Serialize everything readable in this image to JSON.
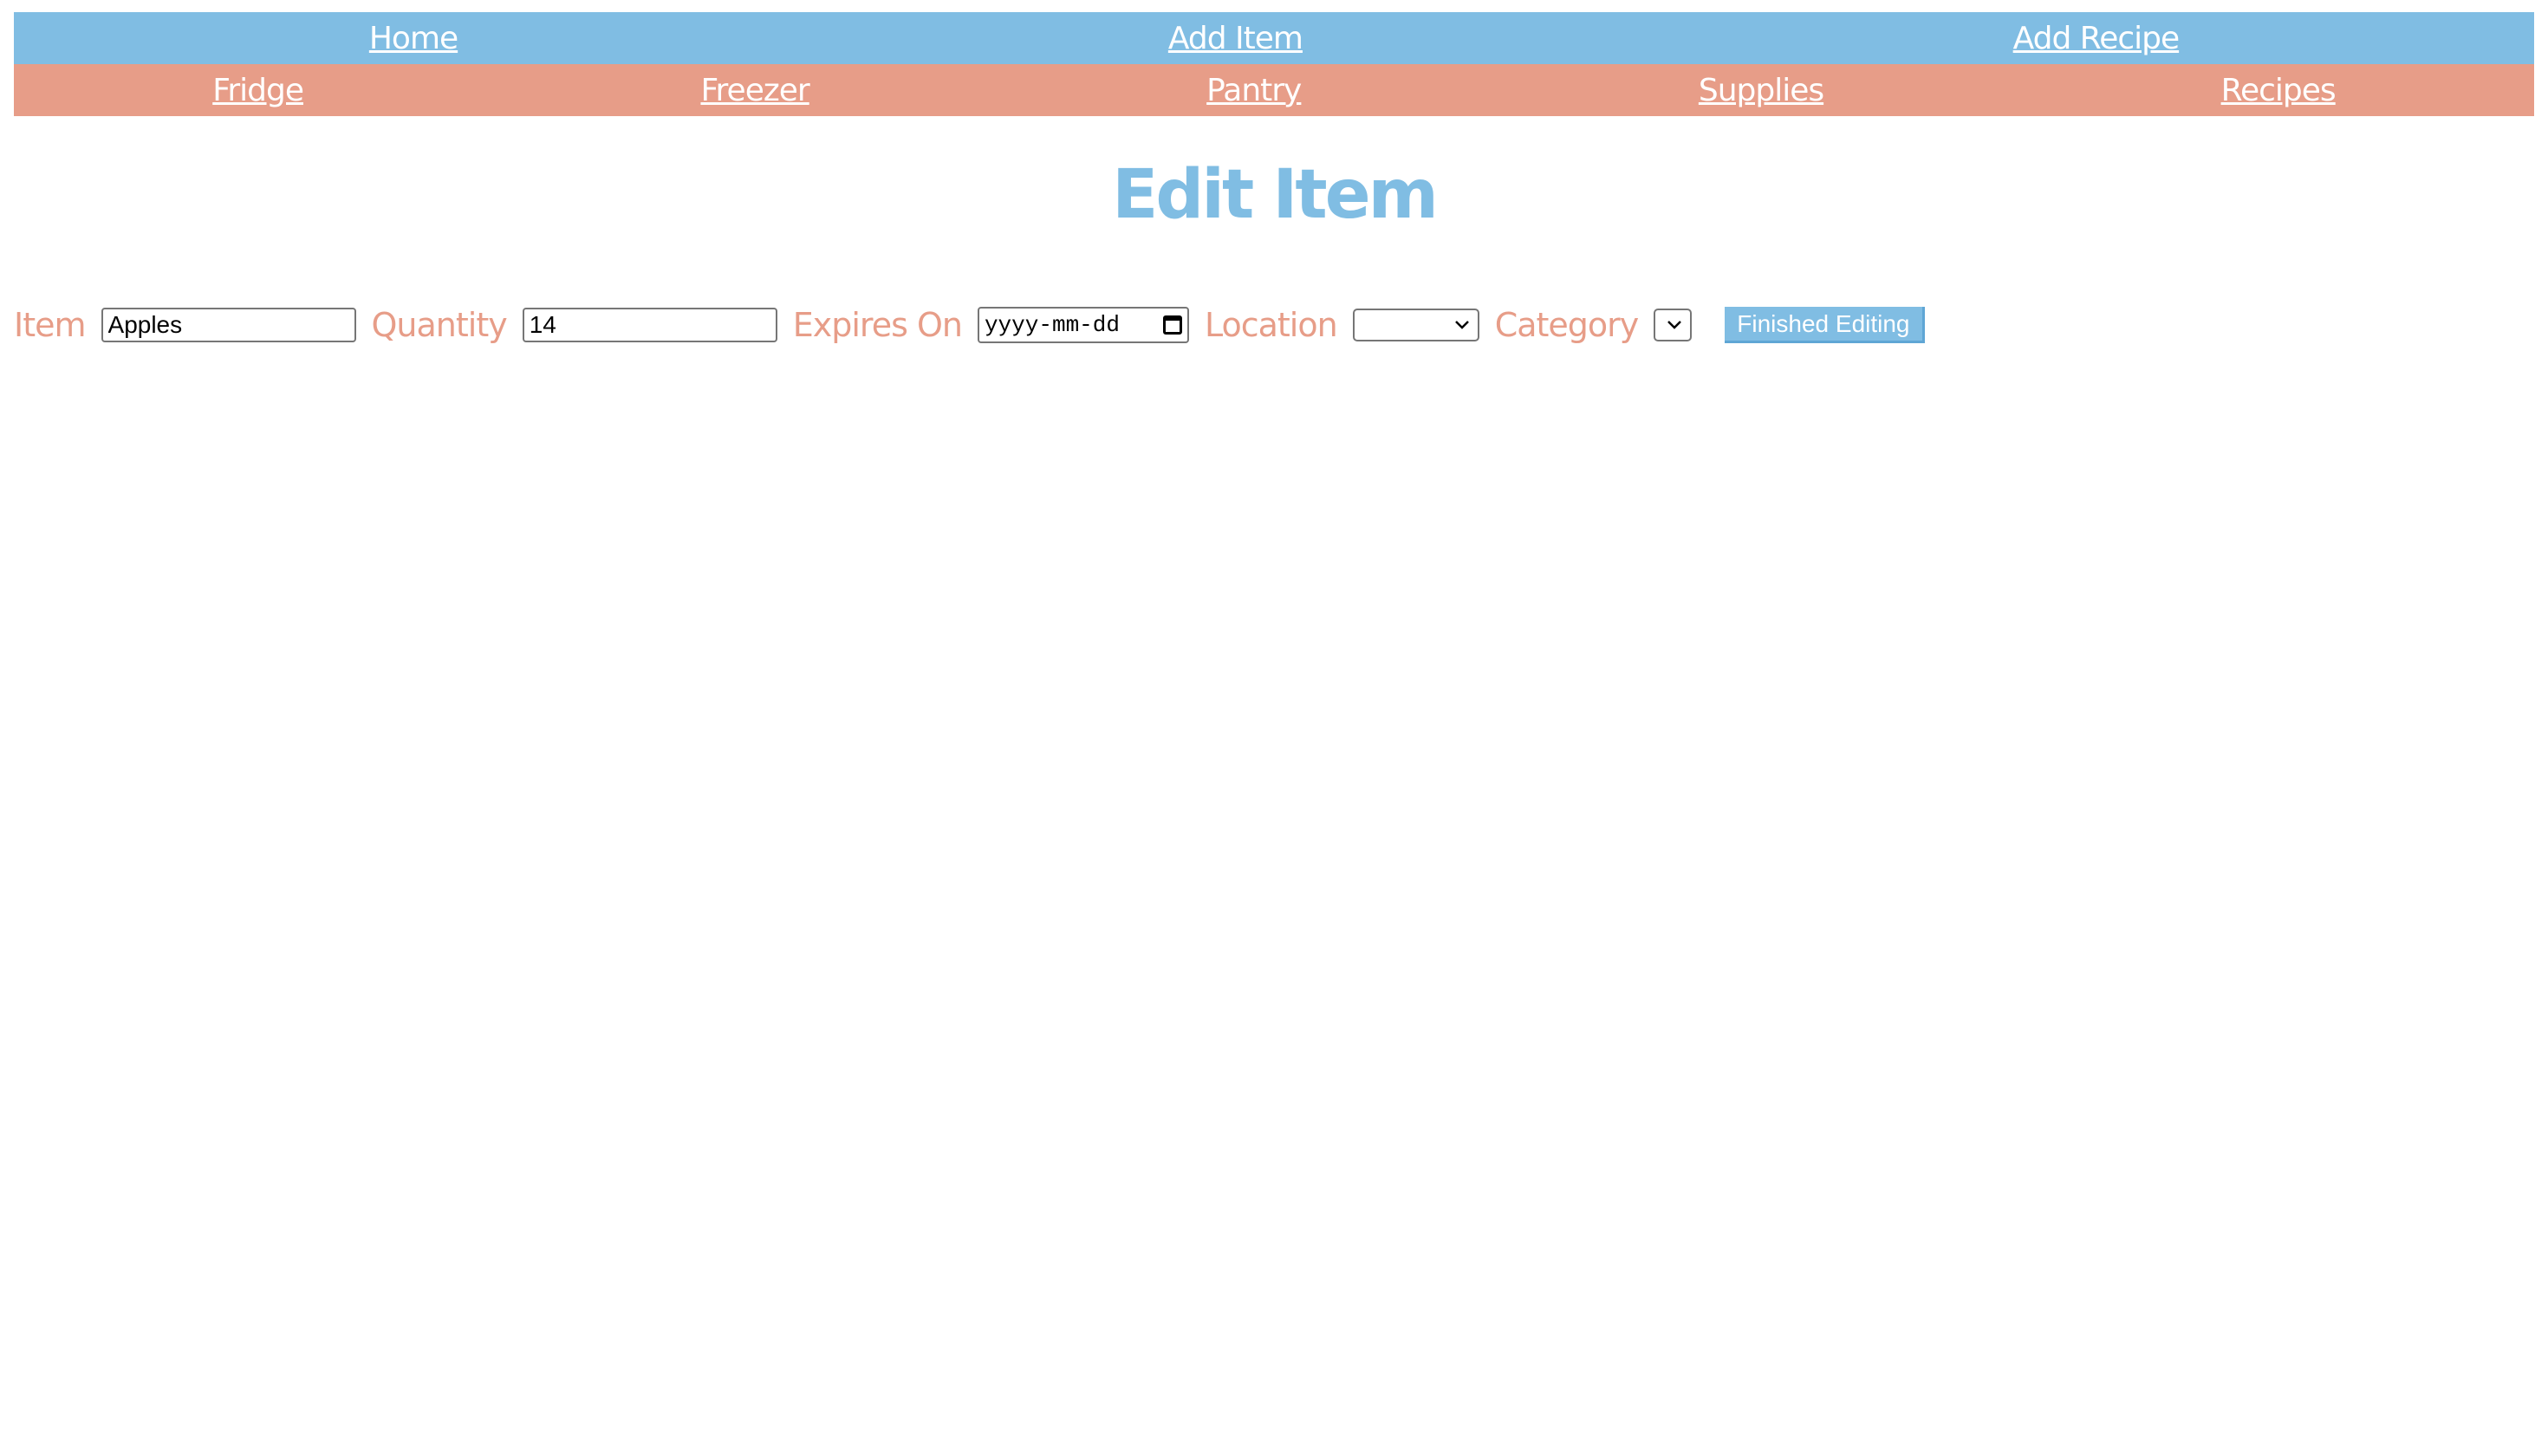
{
  "nav_primary": {
    "items": [
      {
        "label": "Home"
      },
      {
        "label": "Add Item"
      },
      {
        "label": "Add Recipe"
      }
    ]
  },
  "nav_secondary": {
    "items": [
      {
        "label": "Fridge"
      },
      {
        "label": "Freezer"
      },
      {
        "label": "Pantry"
      },
      {
        "label": "Supplies"
      },
      {
        "label": "Recipes"
      }
    ]
  },
  "page": {
    "title": "Edit Item"
  },
  "form": {
    "item_label": "Item",
    "item_value": "Apples",
    "quantity_label": "Quantity",
    "quantity_value": "14",
    "expires_label": "Expires On",
    "expires_placeholder": "yyyy-mm-dd",
    "location_label": "Location",
    "location_value": "",
    "category_label": "Category",
    "category_value": "",
    "submit_label": "Finished Editing"
  },
  "colors": {
    "primary_nav": "#80bde3",
    "secondary_nav": "#e79d88",
    "title": "#80bde3",
    "label": "#e79d88"
  },
  "icons": [
    "calendar-icon",
    "chevron-down-icon"
  ]
}
